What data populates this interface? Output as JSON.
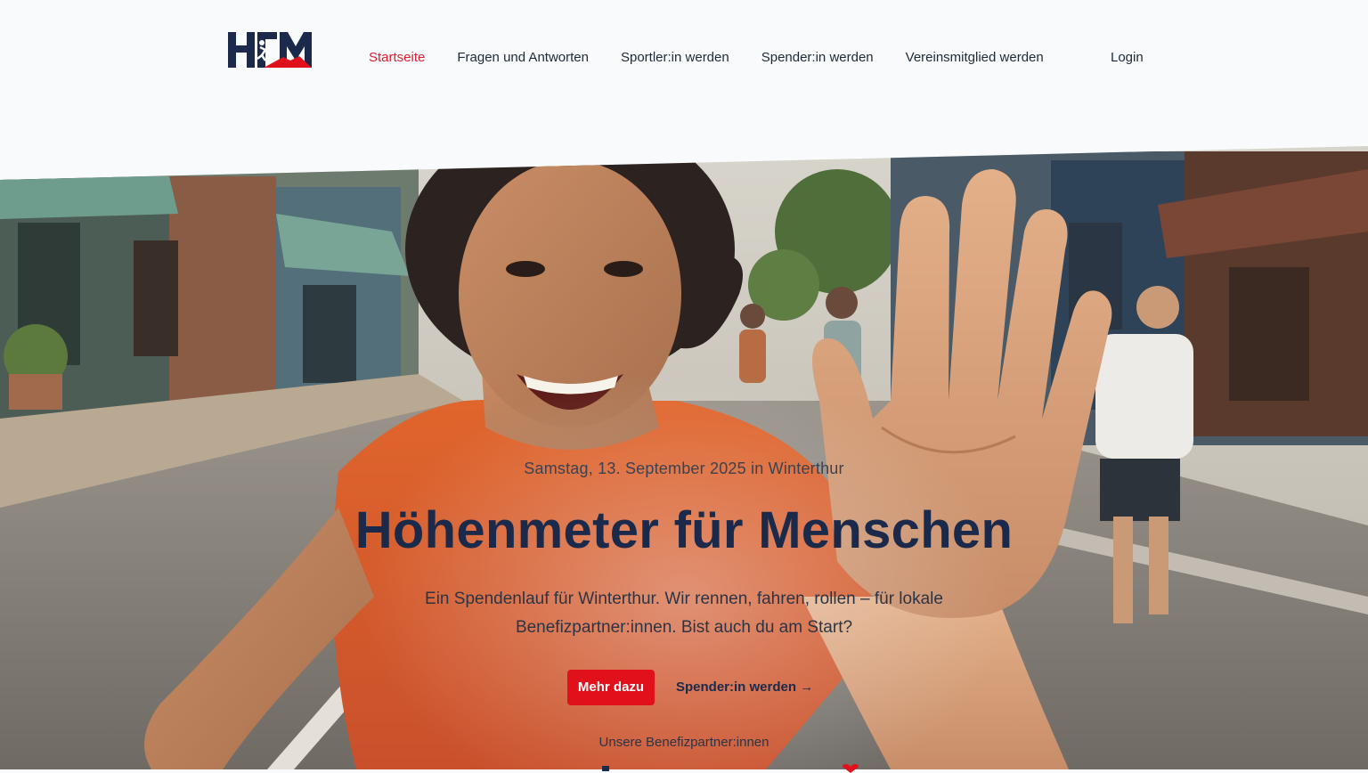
{
  "brand": {
    "logo_text": "HFM",
    "colors": {
      "navy": "#1b2a4a",
      "red": "#e0111b"
    }
  },
  "nav": {
    "items": [
      {
        "label": "Startseite",
        "active": true
      },
      {
        "label": "Fragen und Antworten",
        "active": false
      },
      {
        "label": "Sportler:in werden",
        "active": false
      },
      {
        "label": "Spender:in werden",
        "active": false
      },
      {
        "label": "Vereinsmitglied werden",
        "active": false
      }
    ],
    "login_label": "Login"
  },
  "hero": {
    "eyebrow": "Samstag, 13. September 2025 in Winterthur",
    "title": "Höhenmeter für Menschen",
    "lead": "Ein Spendenlauf für Winterthur. Wir rennen, fahren, rollen – für lokale Benefizpartner:innen. Bist auch du am Start?",
    "primary_cta": "Mehr dazu",
    "secondary_cta": "Spender:in werden →",
    "partners_label": "Unsere Benefizpartner:innen"
  }
}
